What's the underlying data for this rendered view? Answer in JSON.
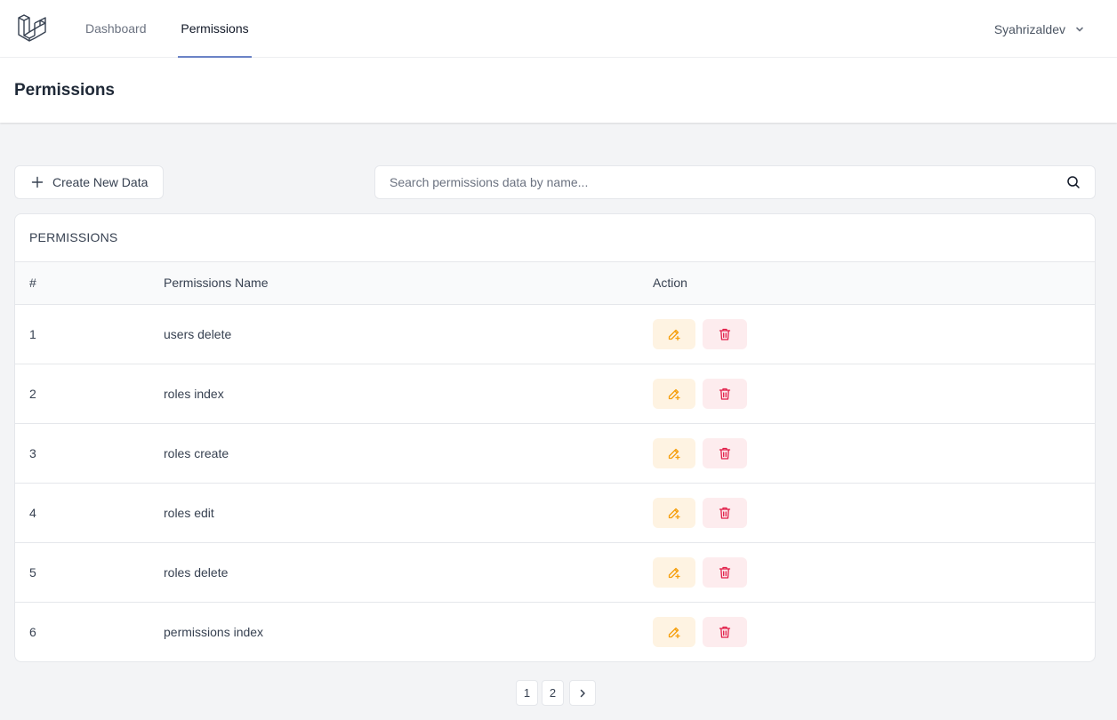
{
  "nav": {
    "links": [
      {
        "label": "Dashboard"
      },
      {
        "label": "Permissions"
      }
    ],
    "user": "Syahrizaldev"
  },
  "header": {
    "title": "Permissions"
  },
  "toolbar": {
    "create_label": "Create New Data",
    "search_placeholder": "Search permissions data by name..."
  },
  "table": {
    "title": "PERMISSIONS",
    "columns": [
      "#",
      "Permissions Name",
      "Action"
    ],
    "rows": [
      {
        "num": "1",
        "name": "users delete"
      },
      {
        "num": "2",
        "name": "roles index"
      },
      {
        "num": "3",
        "name": "roles create"
      },
      {
        "num": "4",
        "name": "roles edit"
      },
      {
        "num": "5",
        "name": "roles delete"
      },
      {
        "num": "6",
        "name": "permissions index"
      }
    ]
  },
  "pagination": {
    "pages": [
      "1",
      "2"
    ]
  },
  "colors": {
    "active_tab": "#6b84c7",
    "edit": "#f59e0b",
    "edit_bg": "#fef3e2",
    "delete": "#e11d48",
    "delete_bg": "#fdecee"
  },
  "icons": {
    "logo": "laravel-logo-icon",
    "chevron": "chevron-down-icon",
    "plus": "plus-icon",
    "search": "search-icon",
    "edit": "pencil-plus-icon",
    "delete": "trash-icon",
    "next": "chevron-right-icon"
  }
}
